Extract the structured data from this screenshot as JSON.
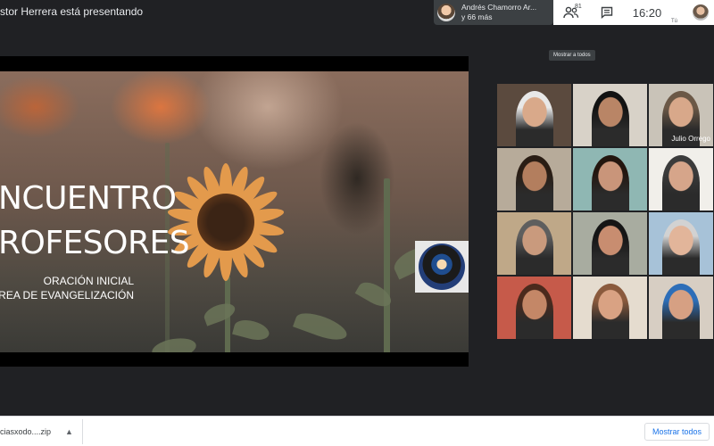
{
  "presenter": {
    "label": "stor Herrera está presentando"
  },
  "participants_chip": {
    "name": "Andrés Chamorro Ar...",
    "more": "y 66 más"
  },
  "topbar": {
    "people_count": "81",
    "people_icon": "people-icon",
    "chat_icon": "chat-icon",
    "time": "16:20",
    "self_label": "Tú"
  },
  "tooltip": {
    "text": "Mostrar a todos"
  },
  "slide": {
    "title_line1": "NCUENTRO",
    "title_line2": "ROFESORES",
    "subtitle_line1": "ORACIÓN INICIAL",
    "subtitle_line2": "ÁREA DE EVANGELIZACIÓN"
  },
  "grid": {
    "tiles": [
      {
        "name": "",
        "bg": "#5b4a3e",
        "face": "#d9a98a",
        "hair": "#e8e8e8"
      },
      {
        "name": "",
        "bg": "#d8d2c8",
        "face": "#b98566",
        "hair": "#121212"
      },
      {
        "name": "Julio Orrego",
        "bg": "#c9c3b8",
        "face": "#d8a88a",
        "hair": "#6b5846"
      },
      {
        "name": "",
        "bg": "#b7ab9a",
        "face": "#b37e5e",
        "hair": "#2a1d14"
      },
      {
        "name": "",
        "bg": "#8fb7b3",
        "face": "#c9957a",
        "hair": "#23160f"
      },
      {
        "name": "",
        "bg": "#f1efea",
        "face": "#d6a58a",
        "hair": "#3b3b3b"
      },
      {
        "name": "",
        "bg": "#bfa888",
        "face": "#c99a7d",
        "hair": "#5e5e5e"
      },
      {
        "name": "",
        "bg": "#a8aca0",
        "face": "#c88d70",
        "hair": "#151515"
      },
      {
        "name": "",
        "bg": "#a7c2d8",
        "face": "#e2b59a",
        "hair": "#d2d2d2"
      },
      {
        "name": "",
        "bg": "#c65a4a",
        "face": "#c48767",
        "hair": "#4b2a1d"
      },
      {
        "name": "",
        "bg": "#e5dccf",
        "face": "#d9a283",
        "hair": "#8a5a3d"
      },
      {
        "name": "",
        "bg": "#d7cec3",
        "face": "#d6a083",
        "hair": "#2d6eb8"
      }
    ]
  },
  "downloads": {
    "file_name": "ciasxodo....zip",
    "show_all_label": "Mostrar todos"
  }
}
